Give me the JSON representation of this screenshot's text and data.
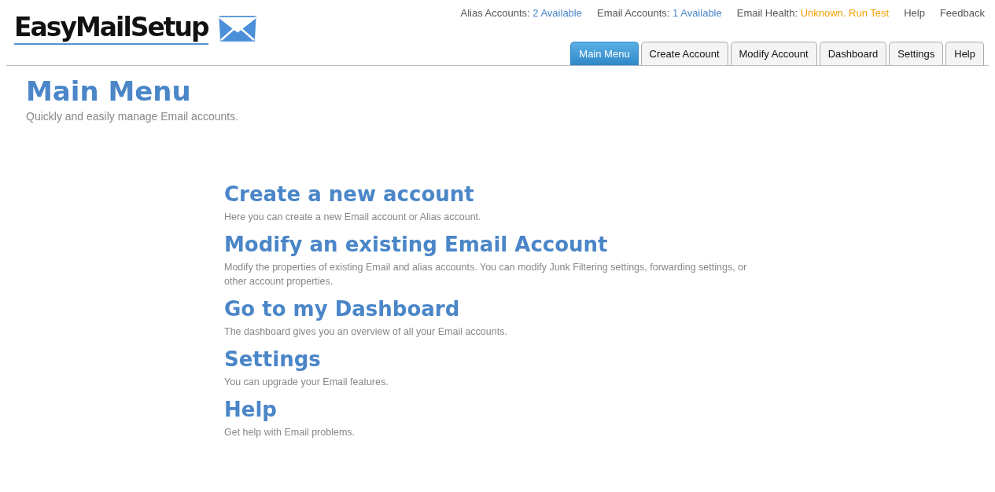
{
  "logo": {
    "text": "EasyMailSetup"
  },
  "status": [
    {
      "label": "Alias Accounts:",
      "value": "2 Available",
      "color": "#4a86c8"
    },
    {
      "label": "Email Accounts:",
      "value": "1 Available",
      "color": "#4a86c8"
    },
    {
      "label": "Email Health:",
      "value": "Unknown. Run Test",
      "color": "#f0a000"
    }
  ],
  "top_links": [
    "Help",
    "Feedback"
  ],
  "tabs": [
    {
      "label": "Main Menu",
      "selected": true
    },
    {
      "label": "Create Account",
      "selected": false
    },
    {
      "label": "Modify Account",
      "selected": false
    },
    {
      "label": "Dashboard",
      "selected": false
    },
    {
      "label": "Settings",
      "selected": false
    },
    {
      "label": "Help",
      "selected": false
    }
  ],
  "page": {
    "title": "Main Menu",
    "subtitle": "Quickly and easily manage Email accounts."
  },
  "menu": [
    {
      "title": "Create a new account",
      "description": "Here you can create a new Email account or Alias account."
    },
    {
      "title": "Modify an existing Email Account",
      "description": "Modify the properties of existing Email and alias accounts. You can modify Junk Filtering settings, forwarding settings, or other account properties."
    },
    {
      "title": "Go to my Dashboard",
      "description": "The dashboard gives you an overview of all your Email accounts."
    },
    {
      "title": "Settings",
      "description": "You can upgrade your Email features."
    },
    {
      "title": "Help",
      "description": "Get help with Email problems."
    }
  ]
}
